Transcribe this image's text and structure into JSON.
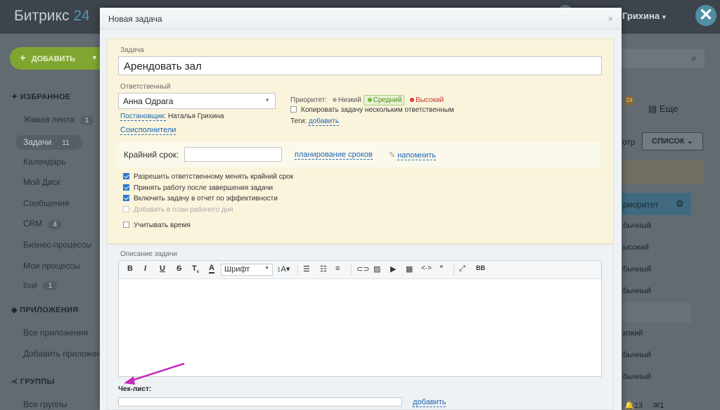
{
  "app": {
    "logo_text": "Битрикс",
    "logo_num": "24",
    "user_name": "Грихина",
    "close_symbol": "✕"
  },
  "sidebar": {
    "add_label": "ДОБАВИТЬ",
    "favorites": "ИЗБРАННОЕ",
    "items": [
      {
        "label": "Живая лента",
        "count": "1"
      },
      {
        "label": "Задачи",
        "count": "11"
      },
      {
        "label": "Календарь",
        "count": ""
      },
      {
        "label": "Мой Диск",
        "count": ""
      },
      {
        "label": "Сообщения",
        "count": ""
      },
      {
        "label": "CRM",
        "count": "4"
      },
      {
        "label": "Бизнес-процессы",
        "count": ""
      },
      {
        "label": "Мои процессы",
        "count": ""
      },
      {
        "label": "Ещё",
        "count": "1"
      }
    ],
    "apps_header": "ПРИЛОЖЕНИЯ",
    "apps": [
      "Все приложения",
      "Добавить приложен"
    ],
    "groups_header": "ГРУППЫ",
    "groups": [
      "Все группы"
    ]
  },
  "right": {
    "more": "Еще",
    "view_prefix": "отр",
    "list_btn": "СПИСОК",
    "priority_header": "риоритет",
    "rows": [
      "бычный",
      "ысокий",
      "бычный",
      "бычный",
      "изкий",
      "бычный",
      "бычный"
    ],
    "badge": "24",
    "bottom_count": "13",
    "bottom_msg": "1"
  },
  "modal": {
    "title": "Новая задача",
    "task_label": "Задача",
    "task_value": "Арендовать зал",
    "responsible_label": "Ответственный",
    "responsible_value": "Анна Одрага",
    "creator_label": "Постановщик:",
    "creator_value": "Наталья Грихина",
    "coexecutors": "Соисполнители",
    "priority_label": "Приоритет:",
    "priority_low": "Низкий",
    "priority_mid": "Средний",
    "priority_high": "Высокий",
    "copy_task": "Копировать задачу нескольким ответственным",
    "tags_label": "Теги:",
    "tags_add": "добавить",
    "deadline_label": "Крайний срок:",
    "deadline_value": "",
    "plan_link": "планирование сроков",
    "remind_link": "напомнить",
    "options": [
      {
        "label": "Разрешить ответственному менять крайний срок",
        "checked": true
      },
      {
        "label": "Принять работу после завершения задачи",
        "checked": true
      },
      {
        "label": "Включить задачу в отчет по эффективности",
        "checked": true
      },
      {
        "label": "Добавить в план рабочего дня",
        "checked": false
      }
    ],
    "track_time": "Учитывать время",
    "description_label": "Описание задачи",
    "font_select": "Шрифт",
    "checklist_label": "Чек-лист:",
    "checklist_add": "добавить"
  },
  "colors": {
    "accent": "#2067b0",
    "panel": "#faf4dc",
    "arrow": "#c62bbd"
  }
}
